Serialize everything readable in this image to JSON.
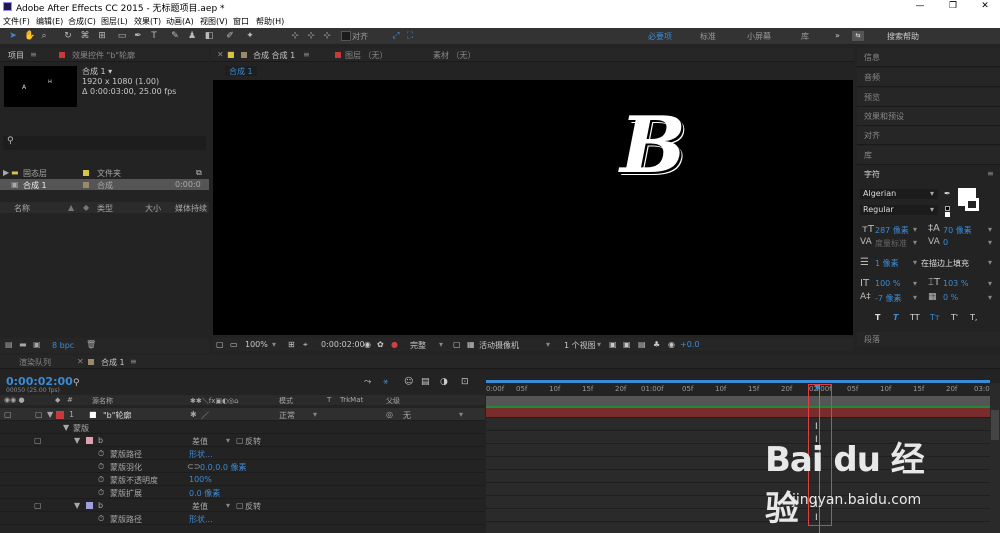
{
  "window": {
    "title": "Adobe After Effects CC 2015 - 无标题项目.aep *"
  },
  "menu": [
    "文件(F)",
    "编辑(E)",
    "合成(C)",
    "图层(L)",
    "效果(T)",
    "动画(A)",
    "视图(V)",
    "窗口",
    "帮助(H)"
  ],
  "toolbar": {
    "snap_label": "对齐",
    "workspaces": [
      "必要项",
      "标准",
      "小屏幕",
      "库"
    ],
    "active_workspace": "必要项",
    "more": "»",
    "search_label": "搜索帮助"
  },
  "project_panel": {
    "tab_label": "项目",
    "effects_tab": "效果控件 \"b\"轮廓",
    "comp_name": "合成 1 ▾",
    "resolution": "1920 x 1080 (1.00)",
    "duration": "Δ 0:00:03:00, 25.00 fps",
    "thumb_text_a": "A",
    "thumb_text_b": "ʜ",
    "columns": {
      "name": "名称",
      "type": "类型",
      "size": "大小",
      "duration": "媒体持续"
    },
    "items": [
      {
        "name": "固态层",
        "type": "文件夹",
        "dur": ""
      },
      {
        "name": "合成 1",
        "type": "合成",
        "dur": "0:00:0"
      }
    ],
    "bpc": "8 bpc"
  },
  "composition_panel": {
    "tab_label": "合成 合成 1",
    "layer_tab": "图层 （无）",
    "footage_tab": "素材 （无）",
    "comp_tag": "合成 1",
    "canvas_glyph": "B",
    "zoom": "100%",
    "time": "0:00:02:00",
    "resolution": "完整",
    "camera": "活动摄像机",
    "views": "1 个视图",
    "exposure": "+0.0"
  },
  "right_panels": {
    "info": "信息",
    "audio": "音频",
    "preview": "预览",
    "effects": "效果和预设",
    "align": "对齐",
    "library": "库",
    "character": "字符",
    "paragraph": "段落"
  },
  "character": {
    "font": "Algerian",
    "style": "Regular",
    "size": "287 像素",
    "leading": "70 像素",
    "kerning": "度量标准",
    "tracking": "0",
    "stroke_width": "1 像素",
    "stroke_mode": "在描边上填充",
    "vscale": "100 %",
    "hscale": "103 %",
    "baseline": "-7 像素",
    "tsume": "0 %",
    "style_buttons": [
      "T",
      "T",
      "TT",
      "Tт",
      "T'",
      "T,"
    ]
  },
  "timeline": {
    "render_tab": "渲染队列",
    "comp_tab": "合成 1",
    "current_time": "0:00:02:00",
    "frame_info": "00050 (25.00 fps)",
    "columns": {
      "source": "源名称",
      "mode": "模式",
      "t": "T",
      "trkmat": "TrkMat",
      "parent": "父级"
    },
    "layers": [
      {
        "num": "1",
        "name": "\"b\"轮廓",
        "mode": "正常",
        "parent": "无"
      }
    ],
    "props": [
      {
        "label": "蒙版",
        "value": ""
      },
      {
        "label": "b",
        "value": "差值",
        "extra": "反转"
      },
      {
        "label": "蒙版路径",
        "value": "形状..."
      },
      {
        "label": "蒙版羽化",
        "value": "0.0,0.0 像素"
      },
      {
        "label": "蒙版不透明度",
        "value": "100%"
      },
      {
        "label": "蒙版扩展",
        "value": "0.0 像素"
      },
      {
        "label": "b",
        "value": "差值",
        "extra": "反转"
      },
      {
        "label": "蒙版路径",
        "value": "形状..."
      }
    ],
    "ruler": [
      "0:00f",
      "05f",
      "10f",
      "15f",
      "20f",
      "01:00f",
      "05f",
      "10f",
      "15f",
      "20f",
      "02:00f",
      "05f",
      "10f",
      "15f",
      "20f",
      "03:0"
    ],
    "playhead_progress": 0.67
  },
  "watermark": {
    "main": "Bai du 经验",
    "sub": "jingyan.baidu.com"
  },
  "colors": {
    "accent": "#3b8bd6",
    "label_red": "#c83a3a",
    "label_yellow": "#d9c24a",
    "track_green": "#1e8b3a"
  }
}
